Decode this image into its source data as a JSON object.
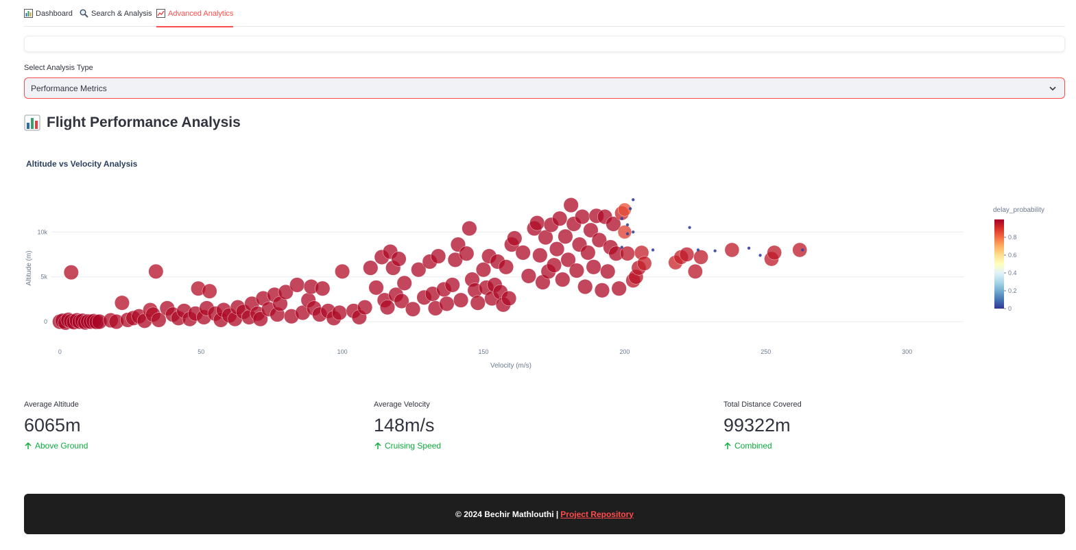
{
  "tabs": [
    {
      "label": "Dashboard",
      "icon": "bar-chart-icon",
      "active": false
    },
    {
      "label": "Search & Analysis",
      "icon": "magnifier-icon",
      "active": false
    },
    {
      "label": "Advanced Analytics",
      "icon": "trend-chart-icon",
      "active": true
    }
  ],
  "select": {
    "label": "Select Analysis Type",
    "value": "Performance Metrics"
  },
  "section": {
    "title": "Flight Performance Analysis",
    "icon": "bar-chart-emoji-icon"
  },
  "chart_data": {
    "type": "scatter",
    "title": "Altitude vs Velocity Analysis",
    "xlabel": "Velocity (m/s)",
    "ylabel": "Altitude (m)",
    "xlim": [
      -3,
      320
    ],
    "ylim": [
      -1600,
      14000
    ],
    "xticks": [
      0,
      50,
      100,
      150,
      200,
      250,
      300
    ],
    "yticks": [
      0,
      5000,
      10000
    ],
    "ytick_labels": [
      "0",
      "5k",
      "10k"
    ],
    "grid": true,
    "colorbar": {
      "title": "delay_probability",
      "ticks": [
        0,
        0.2,
        0.4,
        0.6,
        0.8
      ],
      "colorscale": [
        "#313695",
        "#4575b4",
        "#74add1",
        "#abd9e9",
        "#e0f3f8",
        "#ffffbf",
        "#fee090",
        "#fdae61",
        "#f46d43",
        "#d73027",
        "#a50026"
      ]
    },
    "points": [
      [
        0,
        0,
        0.99
      ],
      [
        1,
        100,
        0.99
      ],
      [
        2,
        -100,
        0.99
      ],
      [
        3,
        200,
        0.99
      ],
      [
        4,
        50,
        0.99
      ],
      [
        5,
        -50,
        0.99
      ],
      [
        6,
        150,
        0.99
      ],
      [
        7,
        0,
        0.99
      ],
      [
        8,
        100,
        0.99
      ],
      [
        9,
        -80,
        0.99
      ],
      [
        10,
        30,
        0.99
      ],
      [
        11,
        0,
        0.99
      ],
      [
        12,
        60,
        0.99
      ],
      [
        13,
        -30,
        0.99
      ],
      [
        14,
        0,
        0.99
      ],
      [
        4,
        5500,
        0.97
      ],
      [
        18,
        150,
        0.98
      ],
      [
        20,
        0,
        0.98
      ],
      [
        22,
        2100,
        0.97
      ],
      [
        24,
        200,
        0.98
      ],
      [
        26,
        400,
        0.98
      ],
      [
        28,
        600,
        0.98
      ],
      [
        30,
        100,
        0.98
      ],
      [
        32,
        1300,
        0.97
      ],
      [
        33,
        800,
        0.98
      ],
      [
        34,
        5600,
        0.97
      ],
      [
        35,
        200,
        0.98
      ],
      [
        38,
        1500,
        0.98
      ],
      [
        40,
        800,
        0.98
      ],
      [
        42,
        400,
        0.98
      ],
      [
        44,
        1200,
        0.98
      ],
      [
        46,
        300,
        0.98
      ],
      [
        48,
        900,
        0.98
      ],
      [
        49,
        3700,
        0.97
      ],
      [
        51,
        500,
        0.98
      ],
      [
        52,
        1500,
        0.98
      ],
      [
        53,
        3400,
        0.97
      ],
      [
        55,
        900,
        0.98
      ],
      [
        57,
        200,
        0.98
      ],
      [
        58,
        1300,
        0.98
      ],
      [
        60,
        700,
        0.98
      ],
      [
        62,
        300,
        0.98
      ],
      [
        63,
        1600,
        0.98
      ],
      [
        65,
        1100,
        0.98
      ],
      [
        67,
        500,
        0.98
      ],
      [
        68,
        2000,
        0.98
      ],
      [
        70,
        900,
        0.98
      ],
      [
        71,
        300,
        0.98
      ],
      [
        72,
        2600,
        0.98
      ],
      [
        74,
        1400,
        0.98
      ],
      [
        76,
        3000,
        0.98
      ],
      [
        77,
        800,
        0.98
      ],
      [
        78,
        2000,
        0.98
      ],
      [
        80,
        3300,
        0.98
      ],
      [
        82,
        600,
        0.98
      ],
      [
        84,
        4100,
        0.98
      ],
      [
        86,
        1000,
        0.98
      ],
      [
        88,
        2400,
        0.98
      ],
      [
        89,
        3900,
        0.98
      ],
      [
        90,
        1500,
        0.98
      ],
      [
        92,
        800,
        0.98
      ],
      [
        93,
        3700,
        0.98
      ],
      [
        95,
        1200,
        0.98
      ],
      [
        97,
        400,
        0.98
      ],
      [
        99,
        1000,
        0.98
      ],
      [
        100,
        5600,
        0.97
      ],
      [
        104,
        1200,
        0.98
      ],
      [
        106,
        500,
        0.98
      ],
      [
        108,
        1600,
        0.98
      ],
      [
        110,
        6000,
        0.98
      ],
      [
        112,
        3800,
        0.98
      ],
      [
        114,
        7200,
        0.98
      ],
      [
        115,
        2400,
        0.98
      ],
      [
        116,
        1600,
        0.98
      ],
      [
        117,
        7800,
        0.98
      ],
      [
        118,
        6000,
        0.98
      ],
      [
        119,
        3000,
        0.98
      ],
      [
        120,
        7000,
        0.98
      ],
      [
        121,
        2300,
        0.98
      ],
      [
        122,
        4300,
        0.98
      ],
      [
        125,
        1400,
        0.98
      ],
      [
        127,
        5800,
        0.98
      ],
      [
        129,
        2700,
        0.98
      ],
      [
        131,
        6700,
        0.98
      ],
      [
        132,
        3100,
        0.98
      ],
      [
        133,
        1500,
        0.98
      ],
      [
        134,
        7300,
        0.98
      ],
      [
        136,
        3600,
        0.98
      ],
      [
        137,
        2000,
        0.98
      ],
      [
        139,
        4100,
        0.98
      ],
      [
        140,
        6900,
        0.98
      ],
      [
        141,
        8600,
        0.98
      ],
      [
        142,
        2400,
        0.98
      ],
      [
        144,
        7600,
        0.98
      ],
      [
        145,
        10400,
        0.98
      ],
      [
        146,
        4700,
        0.98
      ],
      [
        147,
        3500,
        0.98
      ],
      [
        148,
        2100,
        0.98
      ],
      [
        150,
        5800,
        0.98
      ],
      [
        151,
        3800,
        0.98
      ],
      [
        152,
        7300,
        0.98
      ],
      [
        153,
        2600,
        0.98
      ],
      [
        154,
        4100,
        0.98
      ],
      [
        155,
        6700,
        0.98
      ],
      [
        156,
        3300,
        0.98
      ],
      [
        157,
        1900,
        0.98
      ],
      [
        158,
        6100,
        0.98
      ],
      [
        159,
        2600,
        0.98
      ],
      [
        160,
        8600,
        0.98
      ],
      [
        161,
        9300,
        0.98
      ],
      [
        164,
        7700,
        0.98
      ],
      [
        166,
        5100,
        0.98
      ],
      [
        168,
        10400,
        0.98
      ],
      [
        169,
        11000,
        0.98
      ],
      [
        170,
        7400,
        0.98
      ],
      [
        171,
        4400,
        0.98
      ],
      [
        172,
        9400,
        0.98
      ],
      [
        173,
        5600,
        0.98
      ],
      [
        174,
        10800,
        0.98
      ],
      [
        175,
        6300,
        0.98
      ],
      [
        176,
        8100,
        0.98
      ],
      [
        177,
        11500,
        0.98
      ],
      [
        178,
        4700,
        0.98
      ],
      [
        179,
        9500,
        0.98
      ],
      [
        180,
        6900,
        0.98
      ],
      [
        181,
        13000,
        0.98
      ],
      [
        182,
        10900,
        0.98
      ],
      [
        183,
        5700,
        0.98
      ],
      [
        184,
        8600,
        0.98
      ],
      [
        185,
        11700,
        0.98
      ],
      [
        186,
        3900,
        0.98
      ],
      [
        187,
        7700,
        0.98
      ],
      [
        188,
        10200,
        0.98
      ],
      [
        189,
        6100,
        0.98
      ],
      [
        190,
        11800,
        0.98
      ],
      [
        191,
        9100,
        0.98
      ],
      [
        192,
        3500,
        0.98
      ],
      [
        193,
        11700,
        0.98
      ],
      [
        194,
        5600,
        0.98
      ],
      [
        195,
        8300,
        0.98
      ],
      [
        196,
        10900,
        0.98
      ],
      [
        197,
        7600,
        0.98
      ],
      [
        198,
        3700,
        0.98
      ],
      [
        199,
        12100,
        0.93
      ],
      [
        200,
        10000,
        0.88
      ],
      [
        200,
        12500,
        0.85
      ],
      [
        201,
        7600,
        0.96
      ],
      [
        203,
        4600,
        0.96
      ],
      [
        204,
        5000,
        0.96
      ],
      [
        205,
        6000,
        0.96
      ],
      [
        206,
        7700,
        0.94
      ],
      [
        207,
        6500,
        0.94
      ],
      [
        218,
        6600,
        0.93
      ],
      [
        220,
        7200,
        0.94
      ],
      [
        222,
        7500,
        0.95
      ],
      [
        225,
        5600,
        0.96
      ],
      [
        227,
        7200,
        0.95
      ],
      [
        238,
        8000,
        0.95
      ],
      [
        252,
        7000,
        0.95
      ],
      [
        253,
        7700,
        0.95
      ],
      [
        262,
        8000,
        0.95
      ],
      [
        203,
        13600,
        0.02
      ],
      [
        199,
        11500,
        0.02
      ],
      [
        201,
        10800,
        0.02
      ],
      [
        203,
        10000,
        0.02
      ],
      [
        201,
        9800,
        0.02
      ],
      [
        199,
        8300,
        0.02
      ],
      [
        202,
        12600,
        0.02
      ],
      [
        210,
        8000,
        0.02
      ],
      [
        223,
        10500,
        0.02
      ],
      [
        226,
        8000,
        0.02
      ],
      [
        232,
        7900,
        0.02
      ],
      [
        244,
        8200,
        0.02
      ],
      [
        263,
        8000,
        0.02
      ],
      [
        248,
        7400,
        0.02
      ]
    ]
  },
  "metrics": [
    {
      "label": "Average Altitude",
      "value": "6065m",
      "delta": "Above Ground"
    },
    {
      "label": "Average Velocity",
      "value": "148m/s",
      "delta": "Cruising Speed"
    },
    {
      "label": "Total Distance Covered",
      "value": "99322m",
      "delta": "Combined"
    }
  ],
  "footer": {
    "text": "© 2024 Bechir Mathlouthi |",
    "link": "Project Repository"
  },
  "colors": {
    "accent": "#ff4b4b",
    "delta_green": "#09ab3b",
    "footer_bg": "#1e1e1e"
  }
}
